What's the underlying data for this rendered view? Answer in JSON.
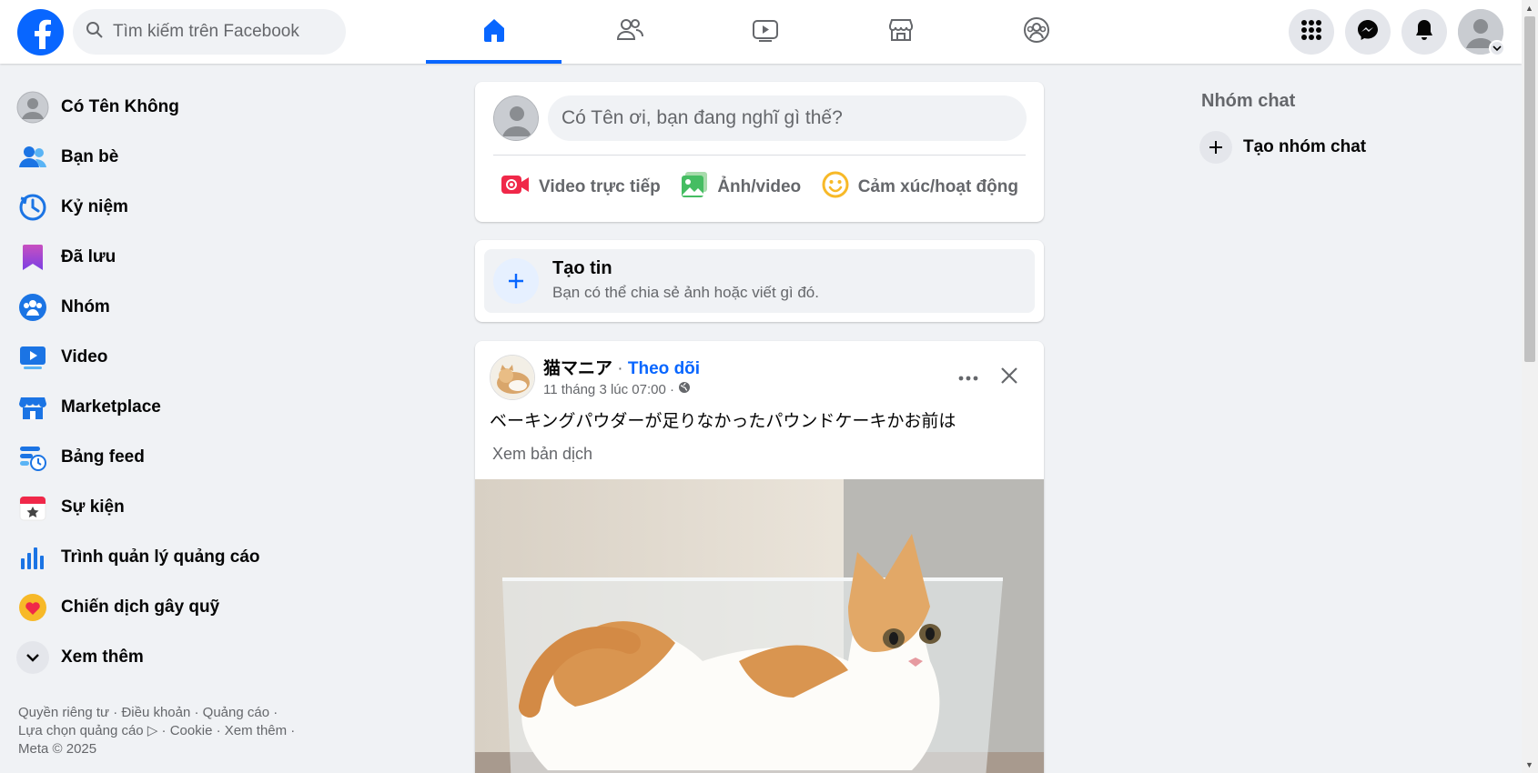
{
  "header": {
    "search_placeholder": "Tìm kiếm trên Facebook",
    "tabs": [
      "home",
      "friends",
      "video",
      "marketplace",
      "groups"
    ],
    "active_tab": "home",
    "accent_color": "#0866ff"
  },
  "sidebar": {
    "items": [
      {
        "label": "Có Tên Không",
        "icon": "avatar-icon"
      },
      {
        "label": "Bạn bè",
        "icon": "friends-icon"
      },
      {
        "label": "Kỷ niệm",
        "icon": "memories-icon"
      },
      {
        "label": "Đã lưu",
        "icon": "saved-icon"
      },
      {
        "label": "Nhóm",
        "icon": "groups-icon"
      },
      {
        "label": "Video",
        "icon": "video-icon"
      },
      {
        "label": "Marketplace",
        "icon": "marketplace-icon"
      },
      {
        "label": "Bảng feed",
        "icon": "feed-icon"
      },
      {
        "label": "Sự kiện",
        "icon": "events-icon"
      },
      {
        "label": "Trình quản lý quảng cáo",
        "icon": "ads-manager-icon"
      },
      {
        "label": "Chiến dịch gây quỹ",
        "icon": "fundraiser-icon"
      },
      {
        "label": "Xem thêm",
        "icon": "chevron-down-icon"
      }
    ],
    "footer": {
      "privacy": "Quyền riêng tư",
      "terms": "Điều khoản",
      "ads": "Quảng cáo",
      "ad_choices": "Lựa chọn quảng cáo",
      "cookies": "Cookie",
      "more": "Xem thêm",
      "copyright": "Meta © 2025"
    }
  },
  "composer": {
    "placeholder": "Có Tên ơi, bạn đang nghĩ gì thế?",
    "live_video": "Video trực tiếp",
    "photo_video": "Ảnh/video",
    "feeling": "Cảm xúc/hoạt động"
  },
  "story": {
    "title": "Tạo tin",
    "subtitle": "Bạn có thể chia sẻ ảnh hoặc viết gì đó."
  },
  "post": {
    "author": "猫マニア",
    "separator": "·",
    "follow": "Theo dõi",
    "time": "11 tháng 3 lúc 07:00 ·",
    "text": "ベーキングパウダーが足りなかったパウンドケーキかお前は",
    "translate": "Xem bản dịch"
  },
  "right": {
    "group_chats": "Nhóm chat",
    "create_group": "Tạo nhóm chat"
  }
}
